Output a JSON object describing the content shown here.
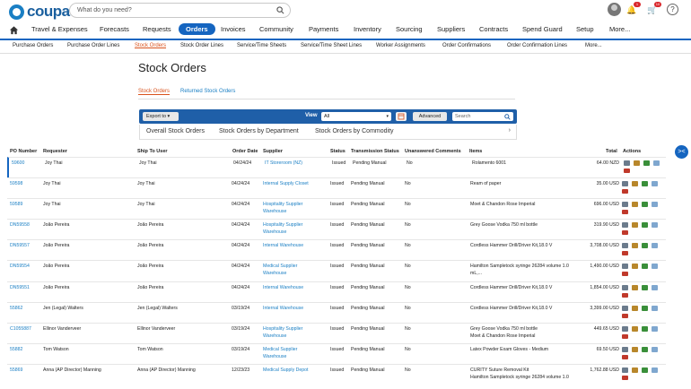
{
  "brand": {
    "name": "coupa",
    "accent": "#1565c0",
    "link": "#1a7fc4",
    "active_orange": "#d9531e"
  },
  "header": {
    "search_placeholder": "What do you need?",
    "notification_count": "1",
    "cart_count": "10",
    "help": "?"
  },
  "main_nav": {
    "home_icon": "home-icon",
    "items": [
      "Travel & Expenses",
      "Forecasts",
      "Requests",
      "Orders",
      "Invoices",
      "Community",
      "Payments",
      "Inventory",
      "Sourcing",
      "Suppliers",
      "Contracts",
      "Spend Guard",
      "Setup",
      "More..."
    ],
    "active": "Orders"
  },
  "sub_nav": {
    "items": [
      "Purchase Orders",
      "Purchase Order Lines",
      "Stock Orders",
      "Stock Order Lines",
      "Service/Time Sheets",
      "Service/Time Sheet Lines",
      "Worker Assignments",
      "Order Confirmations",
      "Order Confirmation Lines",
      "More..."
    ],
    "active": "Stock Orders"
  },
  "page": {
    "title": "Stock Orders",
    "tabs": [
      "Stock Orders",
      "Returned Stock Orders"
    ],
    "active_tab": "Stock Orders"
  },
  "toolbar": {
    "export_label": "Export to",
    "view_label": "View",
    "view_value": "All",
    "advanced_label": "Advanced",
    "search_placeholder": "Search"
  },
  "views": [
    "Overall Stock Orders",
    "Stock Orders by Department",
    "Stock Orders by Commodity"
  ],
  "table": {
    "columns": [
      "PO Number",
      "Requester",
      "Ship To User",
      "Order Date",
      "Supplier",
      "Status",
      "Transmission Status",
      "Unanswered Comments",
      "Items",
      "Total",
      "Actions"
    ],
    "rows": [
      {
        "po": "59600",
        "requester": "Joy Thai",
        "ship_to": "Joy Thai",
        "date": "04/24/24",
        "supplier": [
          "IT Storeroom (NZ)"
        ],
        "status": "Issued",
        "transmission": "Pending Manual",
        "comments": "No",
        "items": [
          "Rolamento 6001"
        ],
        "total": "64.00 NZD"
      },
      {
        "po": "59598",
        "requester": "Joy Thai",
        "ship_to": "Joy Thai",
        "date": "04/24/24",
        "supplier": [
          "Internal Supply Closet"
        ],
        "status": "Issued",
        "transmission": "Pending Manual",
        "comments": "No",
        "items": [
          "Ream of paper"
        ],
        "total": "35.00 USD"
      },
      {
        "po": "59589",
        "requester": "Joy Thai",
        "ship_to": "Joy Thai",
        "date": "04/24/24",
        "supplier": [
          "Hospitality Supplier",
          "Warehouse"
        ],
        "status": "Issued",
        "transmission": "Pending Manual",
        "comments": "No",
        "items": [
          "Moet & Chandon Rose Imperial"
        ],
        "total": "696.00 USD"
      },
      {
        "po": "DN59558",
        "requester": "João Pereira",
        "ship_to": "João Pereira",
        "date": "04/24/24",
        "supplier": [
          "Hospitality Supplier",
          "Warehouse"
        ],
        "status": "Issued",
        "transmission": "Pending Manual",
        "comments": "No",
        "items": [
          "Grey Goose Vodka 750 ml bottle"
        ],
        "total": "319.90 USD"
      },
      {
        "po": "DN59557",
        "requester": "João Pereira",
        "ship_to": "João Pereira",
        "date": "04/24/24",
        "supplier": [
          "Internal Warehouse"
        ],
        "status": "Issued",
        "transmission": "Pending Manual",
        "comments": "No",
        "items": [
          "Cordless Hammer Drill/Driver Kit,18.0 V"
        ],
        "total": "3,708.00 USD"
      },
      {
        "po": "DN59554",
        "requester": "João Pereira",
        "ship_to": "João Pereira",
        "date": "04/24/24",
        "supplier": [
          "Medical Supplier",
          "Warehouse"
        ],
        "status": "Issued",
        "transmission": "Pending Manual",
        "comments": "No",
        "items": [
          "Hamilton Sampletock syringe 26284 volume 1.0",
          "mL,..."
        ],
        "total": "1,490.00 USD"
      },
      {
        "po": "DN59551",
        "requester": "João Pereira",
        "ship_to": "João Pereira",
        "date": "04/24/24",
        "supplier": [
          "Internal Warehouse"
        ],
        "status": "Issued",
        "transmission": "Pending Manual",
        "comments": "No",
        "items": [
          "Cordless Hammer Drill/Driver Kit,18.0 V"
        ],
        "total": "1,854.00 USD"
      },
      {
        "po": "55862",
        "requester": "Jen (Legal) Walters",
        "ship_to": "Jen (Legal) Walters",
        "date": "03/19/24",
        "supplier": [
          "Internal Warehouse"
        ],
        "status": "Issued",
        "transmission": "Pending Manual",
        "comments": "No",
        "items": [
          "Cordless Hammer Drill/Driver Kit,18.0 V"
        ],
        "total": "3,399.00 USD"
      },
      {
        "po": "C1055887",
        "requester": "Ellinor Vanderveer",
        "ship_to": "Ellinor Vanderveer",
        "date": "03/19/24",
        "supplier": [
          "Hospitality Supplier",
          "Warehouse"
        ],
        "status": "Issued",
        "transmission": "Pending Manual",
        "comments": "No",
        "items": [
          "Grey Goose Vodka 750 ml bottle",
          "Moet & Chandon Rose Imperial"
        ],
        "total": "449.65 USD"
      },
      {
        "po": "55882",
        "requester": "Tom Watson",
        "ship_to": "Tom Watson",
        "date": "03/19/24",
        "supplier": [
          "Medical Supplier",
          "Warehouse"
        ],
        "status": "Issued",
        "transmission": "Pending Manual",
        "comments": "No",
        "items": [
          "Latex Powder Exam Gloves - Medium"
        ],
        "total": "69.50 USD"
      },
      {
        "po": "55869",
        "requester": "Anna (AP Director) Manning",
        "ship_to": "Anna (AP Director) Manning",
        "date": "12/23/23",
        "supplier": [
          "Medical Supply Depot"
        ],
        "status": "Issued",
        "transmission": "Pending Manual",
        "comments": "No",
        "items": [
          "CURITY Suture Removal Kit",
          "Hamilton Sampletock syringe 26284 volume 1.0"
        ],
        "total": "1,762.88 USD"
      }
    ]
  }
}
